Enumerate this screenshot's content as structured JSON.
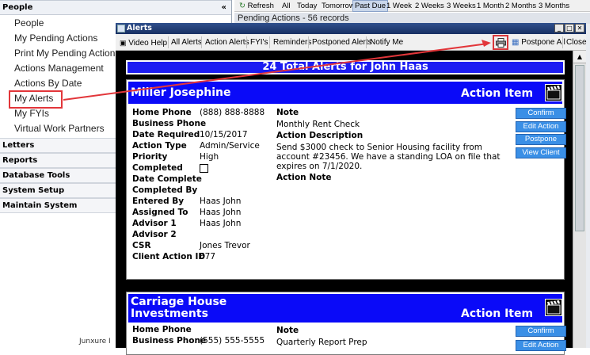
{
  "sidebar": {
    "header": "People",
    "items": [
      {
        "label": "People"
      },
      {
        "label": "My Pending Actions"
      },
      {
        "label": "Print My Pending Actions"
      },
      {
        "label": "Actions Management"
      },
      {
        "label": "Actions By Date"
      },
      {
        "label": "My Alerts"
      },
      {
        "label": "My FYIs"
      },
      {
        "label": "Virtual Work Partners"
      }
    ],
    "sections": [
      "Letters",
      "Reports",
      "Database Tools",
      "System Setup",
      "Maintain System"
    ],
    "footer": "Junxure I"
  },
  "bg_toolbar": {
    "items": [
      "Refresh",
      "All",
      "Today",
      "Tomorrow",
      "Past Due",
      "1 Week",
      "2 Weeks",
      "3 Weeks",
      "1 Month",
      "2 Months",
      "3 Months"
    ],
    "selected": "Past Due",
    "pending": "Pending Actions - 56 records"
  },
  "alerts_window": {
    "title": "Alerts",
    "toolbar": [
      "Video Help",
      "All Alerts",
      "Action Alerts",
      "FYI's",
      "Reminders",
      "Postponed Alerts",
      "Notify Me"
    ],
    "postpone_all": "Postpone All",
    "close": "Close",
    "total_header": "24 Total Alerts for John Haas"
  },
  "cards": [
    {
      "name": "Miller Josephine",
      "type": "Action Item",
      "fields": [
        {
          "label": "Home Phone",
          "value": "(888) 888-8888"
        },
        {
          "label": "Business Phone",
          "value": ""
        },
        {
          "label": "Date Required",
          "value": "10/15/2017"
        },
        {
          "label": "Action Type",
          "value": "Admin/Service"
        },
        {
          "label": "Priority",
          "value": "High"
        },
        {
          "label": "Completed",
          "value": ""
        },
        {
          "label": "Date Complete",
          "value": ""
        },
        {
          "label": "Completed By",
          "value": ""
        },
        {
          "label": "Entered By",
          "value": "Haas John"
        },
        {
          "label": "Assigned To",
          "value": "Haas John"
        },
        {
          "label": "Advisor 1",
          "value": "Haas John"
        },
        {
          "label": "Advisor 2",
          "value": ""
        },
        {
          "label": "CSR",
          "value": "Jones Trevor"
        },
        {
          "label": "Client Action ID",
          "value": "677"
        }
      ],
      "note_label": "Note",
      "note": "Monthly Rent Check",
      "desc_label": "Action Description",
      "description": "Send $3000 check to Senior Housing facility from account #23456. We have a standing LOA on file that expires on 7/1/2020.",
      "action_note_label": "Action Note",
      "buttons": [
        "Confirm",
        "Edit Action",
        "Postpone",
        "View Client"
      ]
    },
    {
      "name": "Carriage House Investments",
      "type": "Action Item",
      "fields": [
        {
          "label": "Home Phone",
          "value": ""
        },
        {
          "label": "Business Phone",
          "value": "(555) 555-5555"
        }
      ],
      "note_label": "Note",
      "note": "Quarterly Report Prep",
      "buttons": [
        "Confirm",
        "Edit Action"
      ]
    }
  ],
  "colors": {
    "accent": "#0a0af8",
    "button": "#3a8fe6",
    "highlight": "#e2363a"
  }
}
